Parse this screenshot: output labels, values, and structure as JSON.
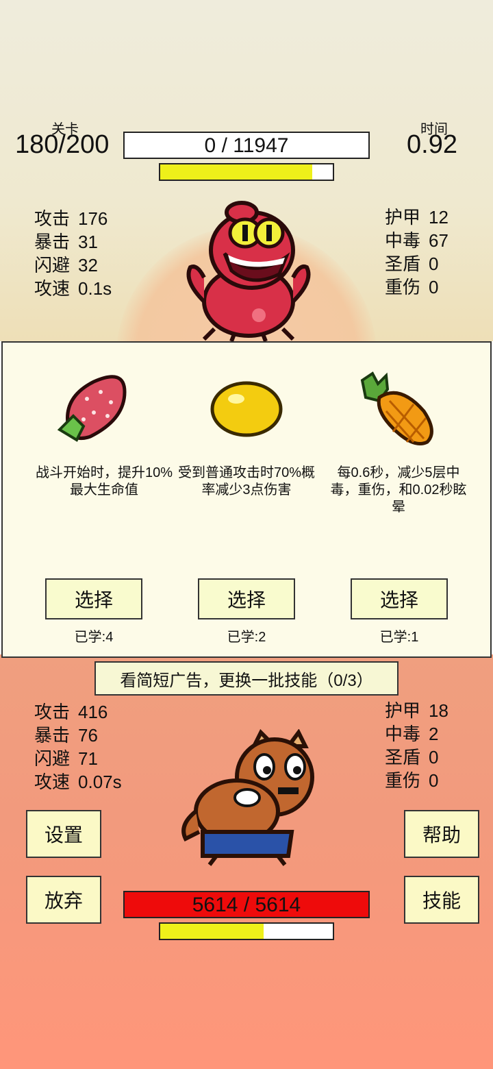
{
  "header": {
    "stage_label": "关卡",
    "stage_value": "180/200",
    "time_label": "时间",
    "time_value": "0.92",
    "enemy_hp_text": "0 / 11947",
    "enemy_hp_fraction": 0,
    "enemy_energy_fraction": 0.88
  },
  "enemy": {
    "left_stats": [
      {
        "name": "攻击",
        "value": "176"
      },
      {
        "name": "暴击",
        "value": "31"
      },
      {
        "name": "闪避",
        "value": "32"
      },
      {
        "name": "攻速",
        "value": "0.1s"
      }
    ],
    "right_stats": [
      {
        "name": "护甲",
        "value": "12"
      },
      {
        "name": "中毒",
        "value": "67"
      },
      {
        "name": "圣盾",
        "value": "0"
      },
      {
        "name": "重伤",
        "value": "0"
      }
    ]
  },
  "choices": [
    {
      "icon": "strawberry-icon",
      "desc": "战斗开始时，提升10%最大生命值",
      "button": "选择",
      "learned": "已学:4"
    },
    {
      "icon": "lemon-icon",
      "desc": "受到普通攻击时70%概率减少3点伤害",
      "button": "选择",
      "learned": "已学:2"
    },
    {
      "icon": "pineapple-icon",
      "desc": "每0.6秒，减少5层中毒，重伤，和0.02秒眩晕",
      "button": "选择",
      "learned": "已学:1"
    }
  ],
  "ad_button": "看简短广告，更换一批技能（0/3）",
  "player": {
    "left_stats": [
      {
        "name": "攻击",
        "value": "416"
      },
      {
        "name": "暴击",
        "value": "76"
      },
      {
        "name": "闪避",
        "value": "71"
      },
      {
        "name": "攻速",
        "value": "0.07s"
      }
    ],
    "right_stats": [
      {
        "name": "护甲",
        "value": "18"
      },
      {
        "name": "中毒",
        "value": "2"
      },
      {
        "name": "圣盾",
        "value": "0"
      },
      {
        "name": "重伤",
        "value": "0"
      }
    ],
    "hp_text": "5614 / 5614",
    "hp_fraction": 1,
    "energy_fraction": 0.6
  },
  "buttons": {
    "settings": "设置",
    "help": "帮助",
    "give_up": "放弃",
    "skills": "技能"
  },
  "colors": {
    "hp_red": "#ee0b0b",
    "energy_yellow": "#eef01a",
    "panel_bg": "#fdfbe8",
    "button_bg": "#fbf9c6"
  }
}
